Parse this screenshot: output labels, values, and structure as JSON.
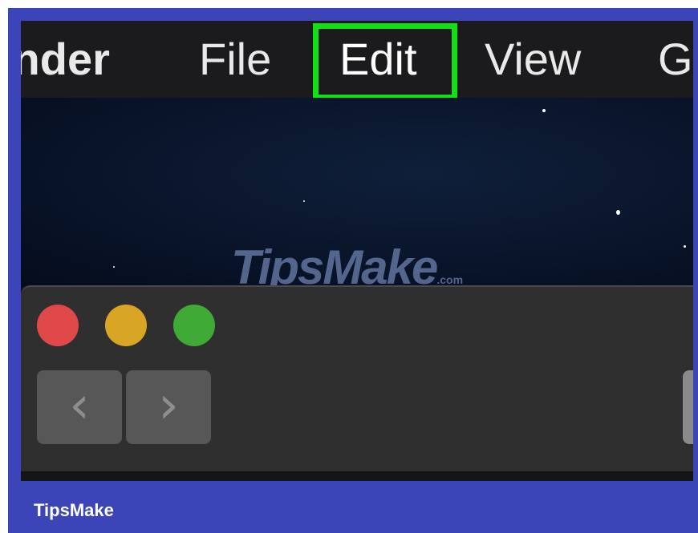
{
  "menubar": {
    "items": [
      {
        "label": "inder"
      },
      {
        "label": "File"
      },
      {
        "label": "Edit",
        "highlighted": true
      },
      {
        "label": "View"
      },
      {
        "label": "G"
      }
    ],
    "highlight_color": "#11e014"
  },
  "window": {
    "traffic_lights": [
      "#e0484a",
      "#d8a624",
      "#3faa35"
    ],
    "nav": {
      "back_glyph": "‹",
      "forward_glyph": "›"
    }
  },
  "watermark": {
    "text": "TipsMake",
    "suffix": ".com"
  },
  "footer": {
    "brand": "TipsMake"
  },
  "colors": {
    "frame": "#3c45b8",
    "menubar": "#1b1b1d",
    "desktop": "#0a1428",
    "window": "#2f2f30"
  }
}
